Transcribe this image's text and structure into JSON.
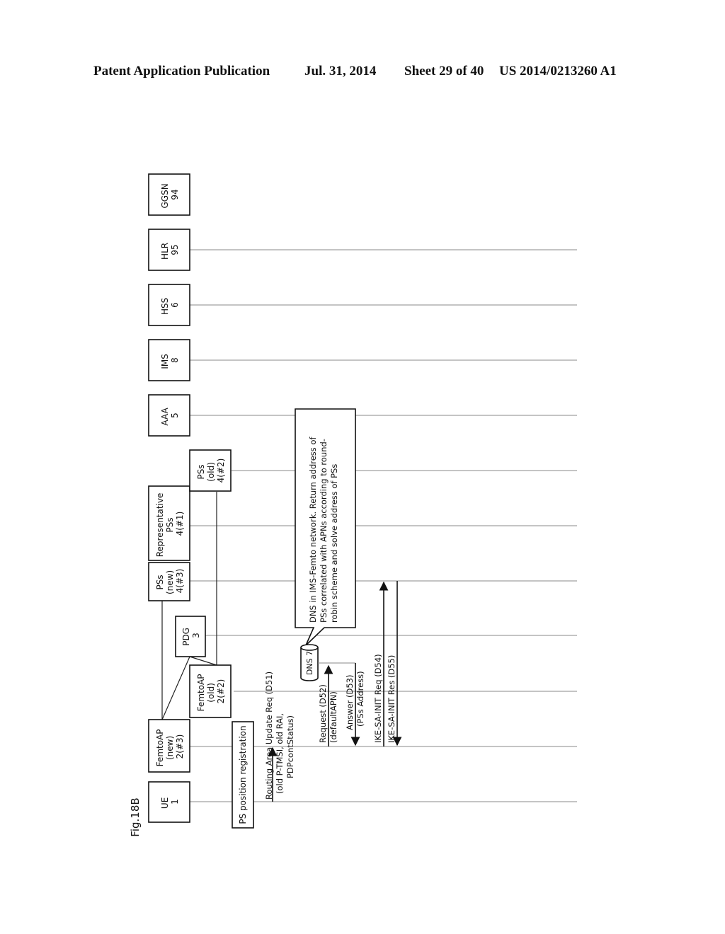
{
  "header": {
    "publication": "Patent Application Publication",
    "date": "Jul. 31, 2014",
    "sheet": "Sheet 29 of 40",
    "number": "US 2014/0213260 A1"
  },
  "figure": {
    "label": "Fig.18B",
    "orientation": "rotated 90° counter-clockwise",
    "entities": [
      {
        "id": "ue",
        "lines": [
          "UE",
          "1"
        ]
      },
      {
        "id": "femto-new",
        "lines": [
          "FemtoAP",
          "(new)",
          "2(#3)"
        ]
      },
      {
        "id": "femto-old",
        "lines": [
          "FemtoAP",
          "(old)",
          "2(#2)"
        ]
      },
      {
        "id": "pdg",
        "lines": [
          "PDG",
          "3"
        ]
      },
      {
        "id": "pss-new",
        "lines": [
          "PSs",
          "(new)",
          "4(#3)"
        ]
      },
      {
        "id": "pss-rep",
        "lines": [
          "Representative",
          "PSs",
          "4(#1)"
        ]
      },
      {
        "id": "pss-old",
        "lines": [
          "PSs",
          "(old)",
          "4(#2)"
        ]
      },
      {
        "id": "aaa",
        "lines": [
          "AAA",
          "5"
        ]
      },
      {
        "id": "ims",
        "lines": [
          "IMS",
          "8"
        ]
      },
      {
        "id": "hss",
        "lines": [
          "HSS",
          "6"
        ]
      },
      {
        "id": "hlr",
        "lines": [
          "HLR",
          "95"
        ]
      },
      {
        "id": "ggsn",
        "lines": [
          "GGSN",
          "94"
        ]
      }
    ],
    "dns": {
      "label": "DNS 7"
    },
    "phase": {
      "label": "PS position registration"
    },
    "note": {
      "lines": [
        "DNS in IMS-Femto network.  Return address of",
        "PSs correlated with APNs according to round-",
        "robin scheme and solve address of PSs"
      ]
    },
    "messages": [
      {
        "id": "D51",
        "from": "ue",
        "to": "femto-new",
        "lines": [
          "Routing Area Update Req (D51)",
          "(old P-TMSI, old RAI,",
          "PDPcontStatus)"
        ]
      },
      {
        "id": "D52",
        "from": "femto-new",
        "to": "dns",
        "lines": [
          "Request (D52)",
          "(defaultAPN)"
        ]
      },
      {
        "id": "D53",
        "from": "dns",
        "to": "femto-new",
        "lines": [
          "Answer (D53)",
          "(PSs Address)"
        ]
      },
      {
        "id": "D54",
        "from": "femto-new",
        "to": "pss-new",
        "lines": [
          "IKE-SA-INIT Req (D54)"
        ]
      },
      {
        "id": "D55",
        "from": "pss-new",
        "to": "femto-new",
        "lines": [
          "IKE-SA-INIT Res (D55)"
        ]
      }
    ]
  }
}
